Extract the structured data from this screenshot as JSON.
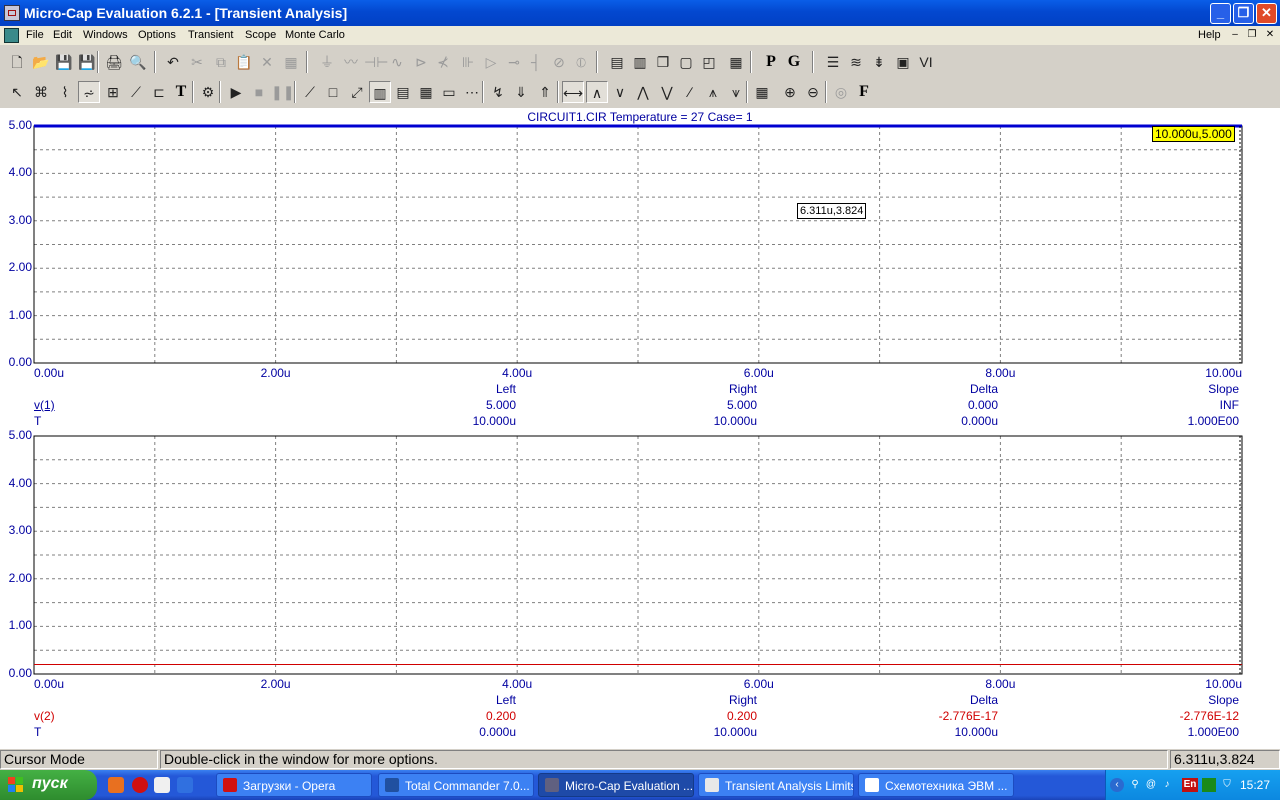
{
  "window": {
    "title": "Micro-Cap Evaluation 6.2.1 - [Transient Analysis]",
    "controls": {
      "minimize": "_",
      "maximize": "❐",
      "close": "✕"
    }
  },
  "menu": {
    "items": [
      "File",
      "Edit",
      "Windows",
      "Options",
      "Transient",
      "Scope",
      "Monte Carlo"
    ],
    "help": "Help",
    "mdi": {
      "minimize": "–",
      "restore": "❐",
      "close": "✕"
    }
  },
  "toolbar1": [
    {
      "icon": "new-file-icon",
      "glyph": "🗋"
    },
    {
      "icon": "open-folder-icon",
      "glyph": "📂"
    },
    {
      "icon": "save-icon",
      "glyph": "💾"
    },
    {
      "icon": "save-all-icon",
      "glyph": "💾"
    },
    {
      "icon": "print-icon",
      "glyph": "🖨"
    },
    {
      "icon": "print-preview-icon",
      "glyph": "🔍"
    },
    {
      "icon": "undo-icon",
      "glyph": "↶"
    },
    {
      "icon": "cut-icon",
      "glyph": "✂",
      "disabled": true
    },
    {
      "icon": "copy-icon",
      "glyph": "⧉",
      "disabled": true
    },
    {
      "icon": "paste-icon",
      "glyph": "📋",
      "disabled": true
    },
    {
      "icon": "delete-icon",
      "glyph": "✕",
      "disabled": true
    },
    {
      "icon": "select-all-icon",
      "glyph": "▦",
      "disabled": true
    },
    {
      "icon": "ground-icon",
      "glyph": "⏚",
      "disabled": true
    },
    {
      "icon": "resistor-icon",
      "glyph": "〰",
      "disabled": true
    },
    {
      "icon": "capacitor-icon",
      "glyph": "⊣⊢",
      "disabled": true
    },
    {
      "icon": "inductor-icon",
      "glyph": "∿",
      "disabled": true
    },
    {
      "icon": "diode-icon",
      "glyph": "⊳",
      "disabled": true
    },
    {
      "icon": "transistor-icon",
      "glyph": "⊀",
      "disabled": true
    },
    {
      "icon": "battery-icon",
      "glyph": "⊪",
      "disabled": true
    },
    {
      "icon": "opamp-icon",
      "glyph": "▷",
      "disabled": true
    },
    {
      "icon": "pin-icon",
      "glyph": "⊸",
      "disabled": true
    },
    {
      "icon": "wire-icon",
      "glyph": "┤",
      "disabled": true
    },
    {
      "icon": "source-icon",
      "glyph": "⊘",
      "disabled": true
    },
    {
      "icon": "current-source-icon",
      "glyph": "⦶",
      "disabled": true
    },
    {
      "icon": "tile-horizontal-icon",
      "glyph": "▤"
    },
    {
      "icon": "tile-vertical-icon",
      "glyph": "▥"
    },
    {
      "icon": "cascade-icon",
      "glyph": "❐"
    },
    {
      "icon": "window-icon",
      "glyph": "▢"
    },
    {
      "icon": "window2-icon",
      "glyph": "◰"
    },
    {
      "icon": "calculator-icon",
      "glyph": "▦"
    },
    {
      "icon": "p-button-icon",
      "glyph": "P"
    },
    {
      "icon": "g-button-icon",
      "glyph": "G"
    },
    {
      "icon": "component-list-icon",
      "glyph": "☰"
    },
    {
      "icon": "waveform-icon",
      "glyph": "≋"
    },
    {
      "icon": "probe-icon",
      "glyph": "⇟"
    },
    {
      "icon": "scope-icon",
      "glyph": "▣"
    },
    {
      "icon": "vi-icon",
      "glyph": "VI"
    }
  ],
  "toolbar2": [
    {
      "icon": "select-arrow-icon",
      "glyph": "↖"
    },
    {
      "icon": "component-icon",
      "glyph": "⌘"
    },
    {
      "icon": "graph-icon",
      "glyph": "⌇"
    },
    {
      "icon": "wire-mode-icon",
      "glyph": "⩫"
    },
    {
      "icon": "bus-icon",
      "glyph": "⊞"
    },
    {
      "icon": "line-mode-icon",
      "glyph": "⟋"
    },
    {
      "icon": "stepping-icon",
      "glyph": "⊏"
    },
    {
      "icon": "text-icon",
      "glyph": "T"
    },
    {
      "icon": "properties-icon",
      "glyph": "⚙"
    },
    {
      "icon": "run-icon",
      "glyph": "▶"
    },
    {
      "icon": "stop-icon",
      "glyph": "■",
      "disabled": true
    },
    {
      "icon": "pause-icon",
      "glyph": "❚❚",
      "disabled": true
    },
    {
      "icon": "scale-icon",
      "glyph": "⟋"
    },
    {
      "icon": "box-icon",
      "glyph": "□"
    },
    {
      "icon": "auto-scale-icon",
      "glyph": "⤢"
    },
    {
      "icon": "grid-icon",
      "glyph": "▥"
    },
    {
      "icon": "minor-grid-icon",
      "glyph": "▤"
    },
    {
      "icon": "grid2-icon",
      "glyph": "▦"
    },
    {
      "icon": "legend-icon",
      "glyph": "▭"
    },
    {
      "icon": "tokens-icon",
      "glyph": "⋯"
    },
    {
      "icon": "cursor-peak-icon",
      "glyph": "↯"
    },
    {
      "icon": "cursor-valley-icon",
      "glyph": "⇓"
    },
    {
      "icon": "cursor-high-icon",
      "glyph": "⇑"
    },
    {
      "icon": "cursor-mode-icon",
      "glyph": "⟷"
    },
    {
      "icon": "peak-icon",
      "glyph": "∧"
    },
    {
      "icon": "valley-icon",
      "glyph": "∨"
    },
    {
      "icon": "high-icon",
      "glyph": "⋀"
    },
    {
      "icon": "low-icon",
      "glyph": "⋁"
    },
    {
      "icon": "inflection-icon",
      "glyph": "∕"
    },
    {
      "icon": "global-high-icon",
      "glyph": "⩚"
    },
    {
      "icon": "global-low-icon",
      "glyph": "⩛"
    },
    {
      "icon": "table-icon",
      "glyph": "▦"
    },
    {
      "icon": "zoom-in-icon",
      "glyph": "⊕"
    },
    {
      "icon": "zoom-out-icon",
      "glyph": "⊖"
    },
    {
      "icon": "target-icon",
      "glyph": "◎",
      "disabled": true
    },
    {
      "icon": "f-button-icon",
      "glyph": "F"
    }
  ],
  "analysis": {
    "title": "CIRCUIT1.CIR Temperature = 27 Case= 1",
    "colors": {
      "blue": "#0000a0",
      "red": "#d00000",
      "grid": "#808080",
      "trace1": "#0000d0",
      "trace2": "#d00000"
    },
    "panels": [
      {
        "y_ticks": [
          "5.00",
          "4.00",
          "3.00",
          "2.00",
          "1.00",
          "0.00"
        ],
        "x_ticks": [
          "0.00u",
          "2.00u",
          "4.00u",
          "6.00u",
          "8.00u",
          "10.00u"
        ],
        "trace_name": "v(1)",
        "x_var": "T",
        "color": "blue",
        "trace_value": 5.0,
        "cursor_headers": [
          "Left",
          "Right",
          "Delta",
          "Slope"
        ],
        "y_values": [
          "5.000",
          "5.000",
          "0.000",
          "INF"
        ],
        "x_values": [
          "10.000u",
          "10.000u",
          "0.000u",
          "1.000E00"
        ],
        "tooltips": [
          {
            "text": "10.000u,5.000",
            "highlight": true
          },
          {
            "text": "6.311u,3.824",
            "highlight": false
          }
        ]
      },
      {
        "y_ticks": [
          "5.00",
          "4.00",
          "3.00",
          "2.00",
          "1.00",
          "0.00"
        ],
        "x_ticks": [
          "0.00u",
          "2.00u",
          "4.00u",
          "6.00u",
          "8.00u",
          "10.00u"
        ],
        "trace_name": "v(2)",
        "x_var": "T",
        "color": "red",
        "trace_value": 0.2,
        "cursor_headers": [
          "Left",
          "Right",
          "Delta",
          "Slope"
        ],
        "y_values": [
          "0.200",
          "0.200",
          "-2.776E-17",
          "-2.776E-12"
        ],
        "x_values": [
          "0.000u",
          "10.000u",
          "10.000u",
          "1.000E00"
        ]
      }
    ]
  },
  "chart_data": [
    {
      "type": "line",
      "title": "CIRCUIT1.CIR Temperature = 27 Case= 1",
      "xlabel": "T",
      "ylabel": "v(1)",
      "xlim": [
        0,
        10
      ],
      "ylim": [
        0,
        5
      ],
      "series": [
        {
          "name": "v(1)",
          "x": [
            0,
            10
          ],
          "y": [
            5.0,
            5.0
          ]
        }
      ],
      "grid": true
    },
    {
      "type": "line",
      "title": "",
      "xlabel": "T",
      "ylabel": "v(2)",
      "xlim": [
        0,
        10
      ],
      "ylim": [
        0,
        5
      ],
      "series": [
        {
          "name": "v(2)",
          "x": [
            0,
            10
          ],
          "y": [
            0.2,
            0.2
          ]
        }
      ],
      "grid": true
    }
  ],
  "status": {
    "mode": "Cursor Mode",
    "hint": "Double-click in the window for more options.",
    "coords": "6.311u,3.824"
  },
  "taskbar": {
    "start_label": "пуск",
    "quicklaunch": [
      "firefox-icon",
      "opera-icon",
      "mail-icon",
      "ie-icon"
    ],
    "tasks": [
      {
        "label": "Загрузки - Opera",
        "icon": "opera-icon",
        "active": false
      },
      {
        "label": "Total Commander 7.0...",
        "icon": "floppy-icon",
        "active": false
      },
      {
        "label": "Micro-Cap Evaluation ...",
        "icon": "microcap-icon",
        "active": true
      },
      {
        "label": "Transient Analysis Limits",
        "icon": "window-icon",
        "active": false
      },
      {
        "label": "Схемотехника ЭВМ ...",
        "icon": "document-icon",
        "active": false
      }
    ],
    "tray_lang": "En",
    "clock": "15:27"
  }
}
